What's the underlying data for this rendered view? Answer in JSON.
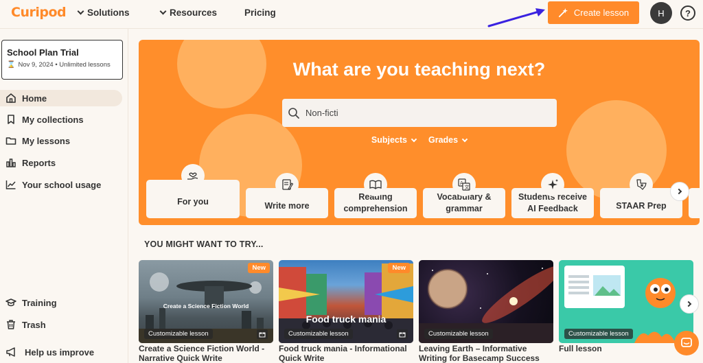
{
  "topbar": {
    "logo": "Curipod",
    "nav": [
      {
        "label": "Solutions"
      },
      {
        "label": "Resources"
      },
      {
        "label": "Pricing"
      }
    ],
    "create_lesson": "Create lesson",
    "avatar_initial": "H",
    "help": "?"
  },
  "sidebar": {
    "plan_title": "School Plan Trial",
    "plan_sub": "Nov 9, 2024 • Unlimited lessons",
    "items": [
      {
        "label": "Home",
        "icon": "home-icon"
      },
      {
        "label": "My collections",
        "icon": "bookmark-icon"
      },
      {
        "label": "My lessons",
        "icon": "folder-icon"
      },
      {
        "label": "Reports",
        "icon": "bar-chart-icon"
      },
      {
        "label": "Your school usage",
        "icon": "line-chart-icon"
      }
    ],
    "bottom_items": [
      {
        "label": "Training",
        "icon": "graduation-cap-icon"
      },
      {
        "label": "Trash",
        "icon": "trash-icon"
      },
      {
        "label": "Help us improve",
        "icon": "megaphone-icon"
      }
    ]
  },
  "hero": {
    "title": "What are you teaching next?",
    "search_value": "Non-ficti",
    "filters": [
      {
        "label": "Subjects"
      },
      {
        "label": "Grades"
      }
    ],
    "categories": [
      {
        "label": "For you",
        "icon": "heart-hand-icon"
      },
      {
        "label": "Write more",
        "icon": "pencil-paper-icon"
      },
      {
        "label": "Reading comprehension",
        "icon": "book-icon"
      },
      {
        "label": "Vocabulary & grammar",
        "icon": "translate-icon"
      },
      {
        "label": "Students receive AI Feedback",
        "icon": "sparkles-icon"
      },
      {
        "label": "STAAR Prep",
        "icon": "texas-star-icon"
      }
    ]
  },
  "suggestions": {
    "title": "YOU MIGHT WANT TO TRY...",
    "badge_customizable": "Customizable lesson",
    "badge_new": "New",
    "lessons": [
      {
        "caption": "Create a Science Fiction World - Narrative Quick Write",
        "overlay": "Create a Science Fiction World",
        "new": true
      },
      {
        "caption": "Food truck mania - Informational Quick Write",
        "overlay": "Food truck mania",
        "new": true
      },
      {
        "caption": "Leaving Earth – Informative Writing for Basecamp Success",
        "overlay": "",
        "new": false
      },
      {
        "caption": "Full lesson",
        "overlay": "",
        "new": false
      }
    ]
  },
  "colors": {
    "brand": "#ff8a2a",
    "hero": "#ff8e2b",
    "arrow": "#3a22e0"
  }
}
